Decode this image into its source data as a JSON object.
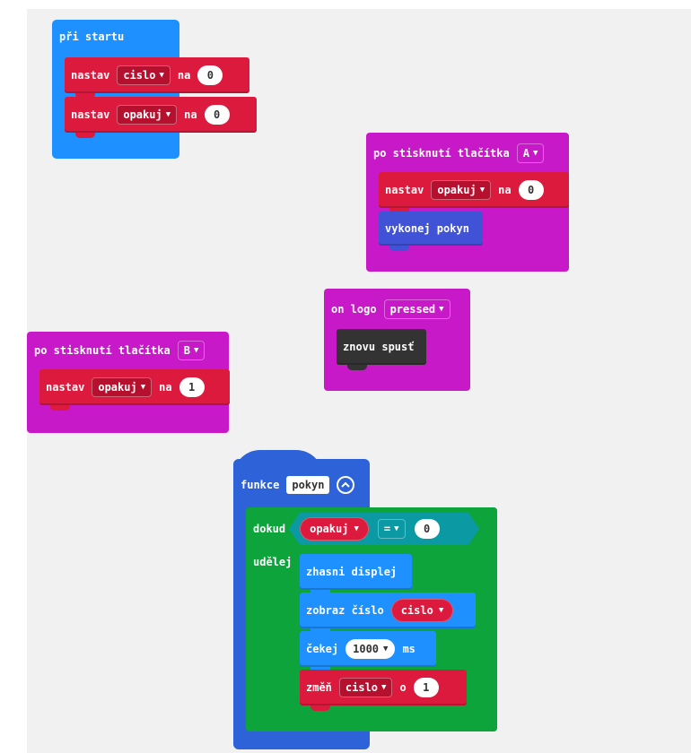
{
  "on_start": {
    "header": "při startu",
    "rows": [
      {
        "kw": "nastav",
        "var": "cislo",
        "na": "na",
        "value": "0"
      },
      {
        "kw": "nastav",
        "var": "opakuj",
        "na": "na",
        "value": "0"
      }
    ]
  },
  "button_a": {
    "header": "po stisknutí tlačítka",
    "button": "A",
    "set_row": {
      "kw": "nastav",
      "var": "opakuj",
      "na": "na",
      "value": "0"
    },
    "call": "vykonej pokyn"
  },
  "logo": {
    "header": "on logo",
    "event": "pressed",
    "body": "znovu spusť"
  },
  "button_b": {
    "header": "po stisknutí tlačítka",
    "button": "B",
    "set_row": {
      "kw": "nastav",
      "var": "opakuj",
      "na": "na",
      "value": "1"
    }
  },
  "function": {
    "kw": "funkce",
    "name": "pokyn",
    "while_kw": "dokud",
    "do_kw": "udělej",
    "cond_var": "opakuj",
    "cond_op": "=",
    "cond_val": "0",
    "clear": "zhasni displej",
    "show_number": "zobraz číslo",
    "show_var": "cislo",
    "pause": "čekej",
    "pause_value": "1000",
    "pause_unit": "ms",
    "change": "změň",
    "change_var": "cislo",
    "change_by": "o",
    "change_value": "1"
  },
  "icons": {
    "dropdown": "chevron-down-icon",
    "collapse": "collapse-circle-icon"
  }
}
